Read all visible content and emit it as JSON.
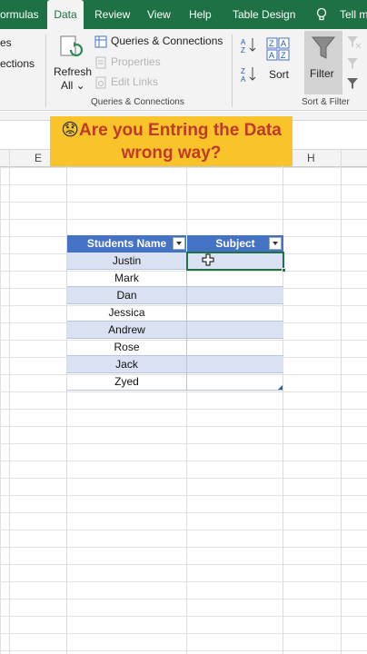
{
  "tabs": [
    {
      "label": "ormulas",
      "active": false
    },
    {
      "label": "Data",
      "active": true
    },
    {
      "label": "Review",
      "active": false
    },
    {
      "label": "View",
      "active": false
    },
    {
      "label": "Help",
      "active": false
    },
    {
      "label": "Table Design",
      "active": false
    },
    {
      "label": "Tell m",
      "active": false
    }
  ],
  "ribbon": {
    "left_partial": [
      "es",
      "ections"
    ],
    "refresh_label": "Refresh",
    "refresh_sub": "All",
    "queries_connections": "Queries & Connections",
    "properties": "Properties",
    "edit_links": "Edit Links",
    "group_queries": "Queries & Connections",
    "sort": "Sort",
    "filter": "Filter",
    "group_sort": "Sort & Filter",
    "sort_az_icon": "sort-ascending-icon",
    "sort_za_icon": "sort-descending-icon"
  },
  "banner": {
    "emoji": "😟",
    "text": "Are you Entring the Data wrong way?"
  },
  "columns": {
    "e": "E",
    "h": "H"
  },
  "table": {
    "headers": [
      "Students Name",
      "Subject"
    ],
    "rows": [
      "Justin",
      "Mark",
      "Dan",
      "Jessica",
      "Andrew",
      "Rose",
      "Jack",
      "Zyed"
    ]
  },
  "colors": {
    "excel_green": "#1e7145",
    "table_header": "#4472c4",
    "band": "#d9e1f2",
    "banner_bg": "#f8c42a",
    "banner_text": "#c0392b"
  }
}
